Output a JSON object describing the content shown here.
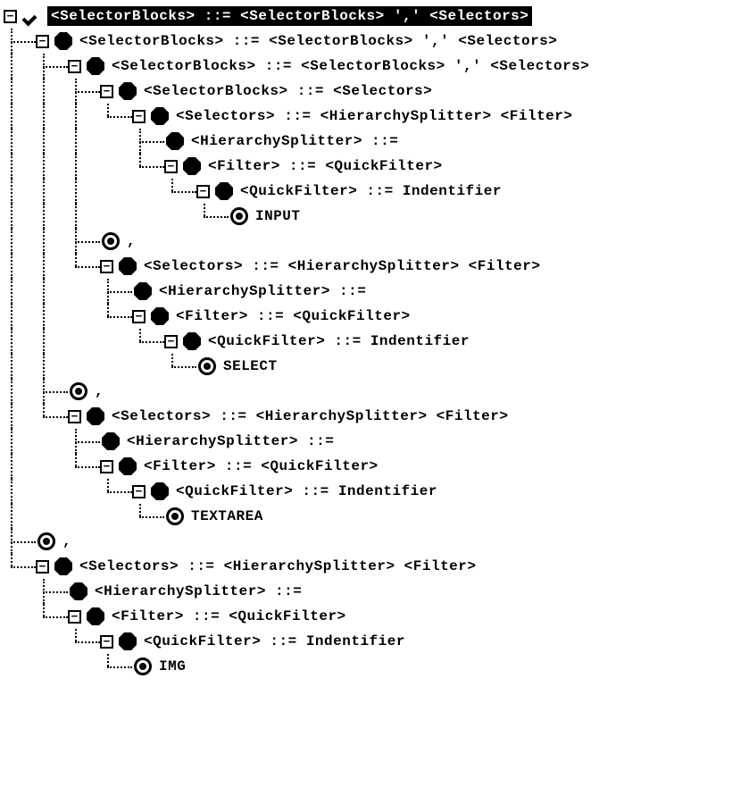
{
  "tree": {
    "label": "<SelectorBlocks> ::= <SelectorBlocks> ',' <Selectors>",
    "icon": "check",
    "selected": true,
    "expanded": true,
    "children": [
      {
        "label": "<SelectorBlocks> ::= <SelectorBlocks> ',' <Selectors>",
        "icon": "hex",
        "expanded": true,
        "children": [
          {
            "label": "<SelectorBlocks> ::= <SelectorBlocks> ',' <Selectors>",
            "icon": "hex",
            "expanded": true,
            "children": [
              {
                "label": "<SelectorBlocks> ::= <Selectors>",
                "icon": "hex",
                "expanded": true,
                "children": [
                  {
                    "label": "<Selectors> ::= <HierarchySplitter> <Filter>",
                    "icon": "hex",
                    "expanded": true,
                    "children": [
                      {
                        "label": "<HierarchySplitter> ::=",
                        "icon": "hex",
                        "expanded": null
                      },
                      {
                        "label": "<Filter> ::= <QuickFilter>",
                        "icon": "hex",
                        "expanded": true,
                        "children": [
                          {
                            "label": "<QuickFilter> ::= Indentifier",
                            "icon": "hex",
                            "expanded": true,
                            "children": [
                              {
                                "label": "INPUT",
                                "icon": "target",
                                "expanded": null
                              }
                            ]
                          }
                        ]
                      }
                    ]
                  }
                ]
              },
              {
                "label": ",",
                "icon": "target",
                "expanded": null
              },
              {
                "label": "<Selectors> ::= <HierarchySplitter> <Filter>",
                "icon": "hex",
                "expanded": true,
                "children": [
                  {
                    "label": "<HierarchySplitter> ::=",
                    "icon": "hex",
                    "expanded": null
                  },
                  {
                    "label": "<Filter> ::= <QuickFilter>",
                    "icon": "hex",
                    "expanded": true,
                    "children": [
                      {
                        "label": "<QuickFilter> ::= Indentifier",
                        "icon": "hex",
                        "expanded": true,
                        "children": [
                          {
                            "label": "SELECT",
                            "icon": "target",
                            "expanded": null
                          }
                        ]
                      }
                    ]
                  }
                ]
              }
            ]
          },
          {
            "label": ",",
            "icon": "target",
            "expanded": null
          },
          {
            "label": "<Selectors> ::= <HierarchySplitter> <Filter>",
            "icon": "hex",
            "expanded": true,
            "children": [
              {
                "label": "<HierarchySplitter> ::=",
                "icon": "hex",
                "expanded": null
              },
              {
                "label": "<Filter> ::= <QuickFilter>",
                "icon": "hex",
                "expanded": true,
                "children": [
                  {
                    "label": "<QuickFilter> ::= Indentifier",
                    "icon": "hex",
                    "expanded": true,
                    "children": [
                      {
                        "label": "TEXTAREA",
                        "icon": "target",
                        "expanded": null
                      }
                    ]
                  }
                ]
              }
            ]
          }
        ]
      },
      {
        "label": ",",
        "icon": "target",
        "expanded": null
      },
      {
        "label": "<Selectors> ::= <HierarchySplitter> <Filter>",
        "icon": "hex",
        "expanded": true,
        "children": [
          {
            "label": "<HierarchySplitter> ::=",
            "icon": "hex",
            "expanded": null
          },
          {
            "label": "<Filter> ::= <QuickFilter>",
            "icon": "hex",
            "expanded": true,
            "children": [
              {
                "label": "<QuickFilter> ::= Indentifier",
                "icon": "hex",
                "expanded": true,
                "children": [
                  {
                    "label": "IMG",
                    "icon": "target",
                    "expanded": null
                  }
                ]
              }
            ]
          }
        ]
      }
    ]
  }
}
